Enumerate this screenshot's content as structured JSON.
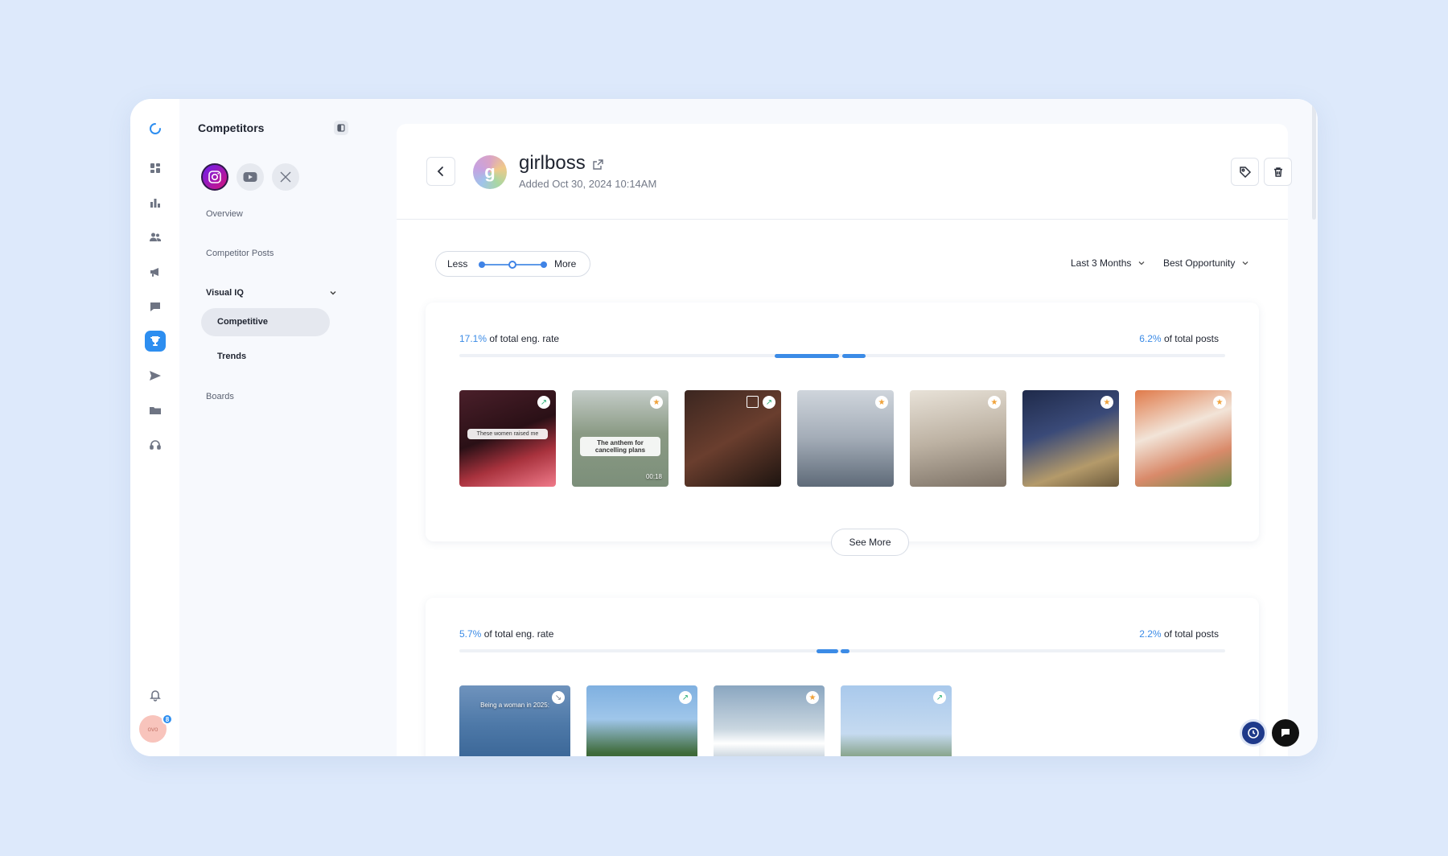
{
  "sidebar": {
    "title": "Competitors",
    "platforms": [
      "instagram-icon",
      "youtube-icon",
      "x-icon"
    ],
    "nav": {
      "overview": "Overview",
      "competitor_posts": "Competitor Posts",
      "visual_iq": "Visual IQ",
      "competitive": "Competitive",
      "trends": "Trends",
      "boards": "Boards"
    }
  },
  "rail": {
    "avatar_text": "ovo",
    "notification_count": "8"
  },
  "header": {
    "brand_initial": "g",
    "brand_name": "girlboss",
    "added": "Added Oct 30, 2024 10:14AM"
  },
  "filters": {
    "less": "Less",
    "more": "More",
    "date_range": "Last 3 Months",
    "sort": "Best Opportunity"
  },
  "groups": [
    {
      "eng_pct": "17.1%",
      "eng_label": "of total eng. rate",
      "posts_pct": "6.2%",
      "posts_label": "of total posts",
      "see_more": "See More",
      "thumbs": [
        {
          "badge": "trend-up-icon",
          "caption": "These women raised me"
        },
        {
          "badge": "star-icon",
          "caption": "The anthem for cancelling plans",
          "duration": "00:18"
        },
        {
          "badge": "trend-up-icon",
          "caption": ""
        },
        {
          "badge": "star-icon",
          "caption": ""
        },
        {
          "badge": "star-icon",
          "caption": ""
        },
        {
          "badge": "star-icon",
          "caption": ""
        },
        {
          "badge": "star-icon",
          "caption": ""
        }
      ]
    },
    {
      "eng_pct": "5.7%",
      "eng_label": "of total eng. rate",
      "posts_pct": "2.2%",
      "posts_label": "of total posts",
      "thumbs": [
        {
          "badge": "trend-down-icon",
          "caption": "Being a woman in 2025:"
        },
        {
          "badge": "trend-up-icon",
          "caption": ""
        },
        {
          "badge": "star-icon",
          "caption": ""
        },
        {
          "badge": "trend-up-icon",
          "caption": ""
        }
      ]
    }
  ],
  "colors": {
    "accent": "#3b8be6",
    "page_bg": "#dde9fb",
    "star": "#f0a23a",
    "trend": "#2fb27a"
  }
}
